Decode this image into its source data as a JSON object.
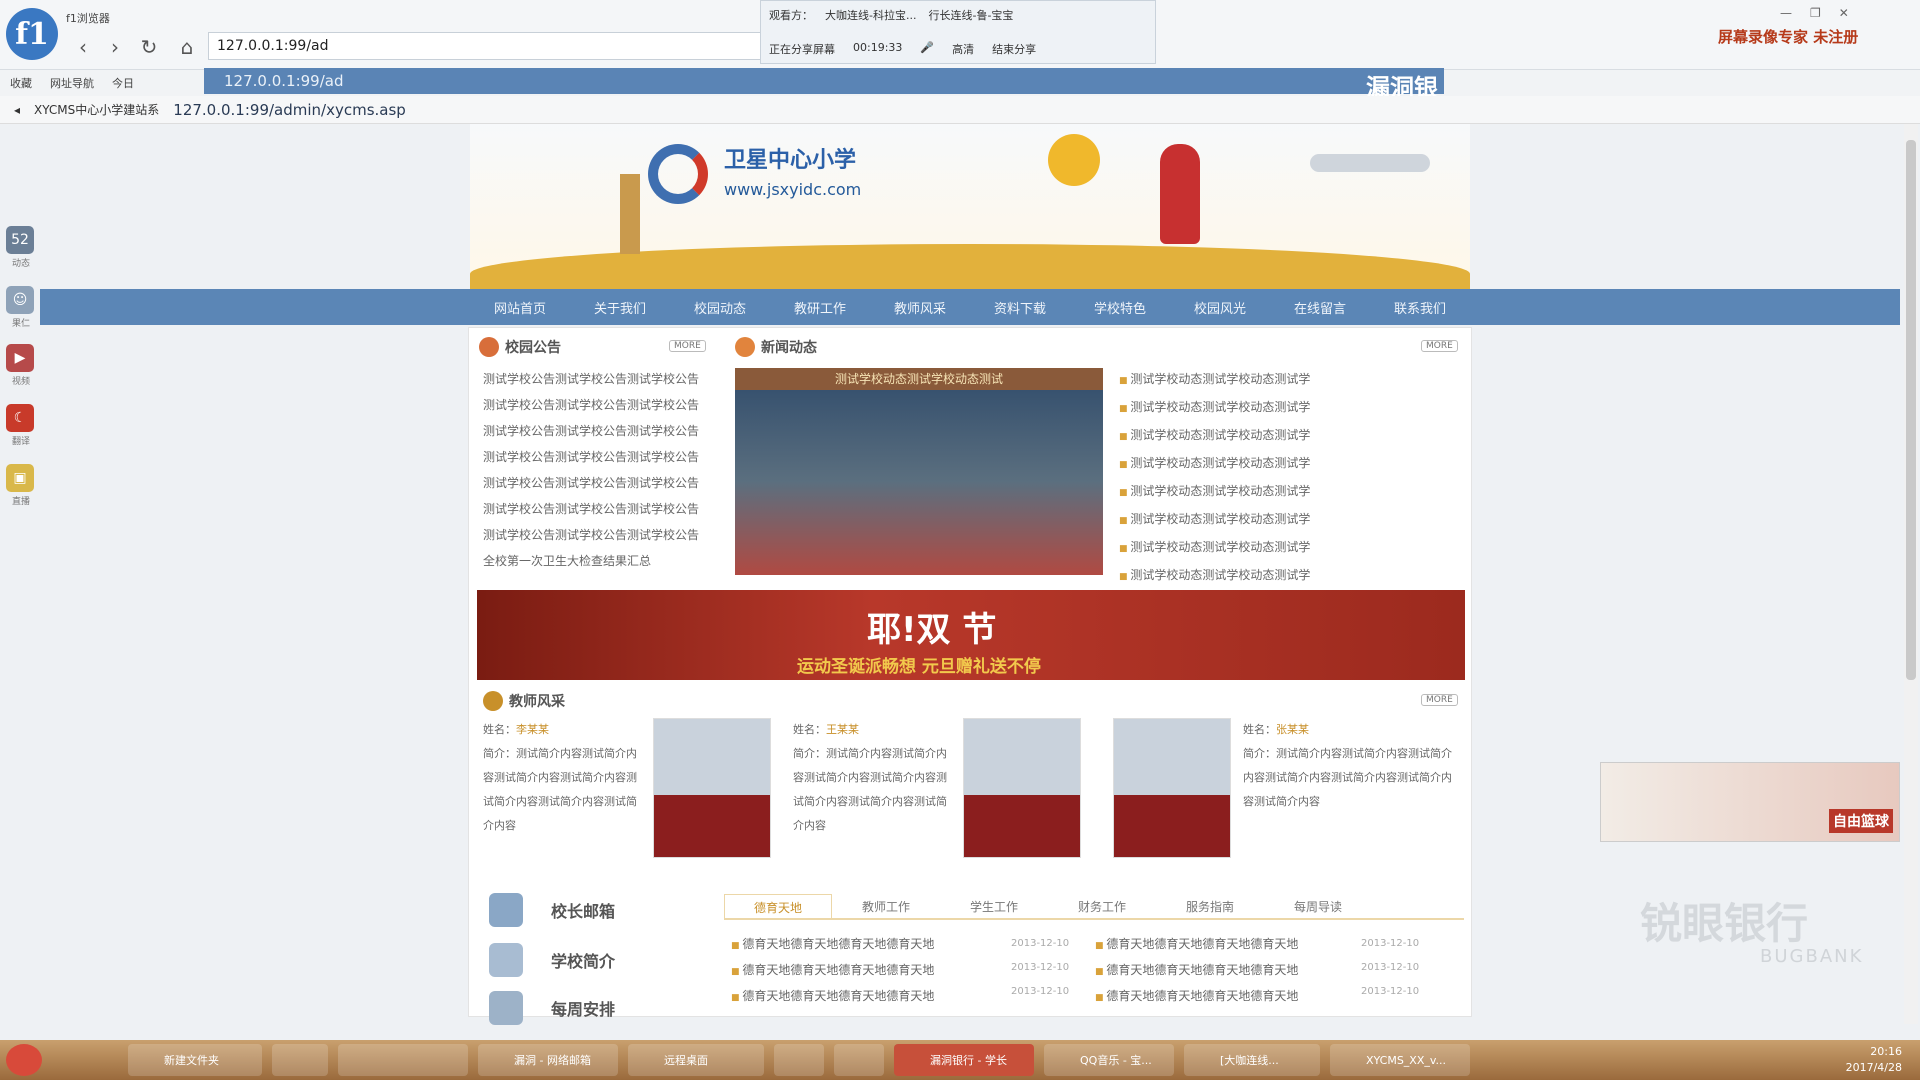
{
  "browser": {
    "app_title": "f1浏览器",
    "address_value": "127.0.0.1:99/ad",
    "suggestion_url": "127.0.0.1:99/ad",
    "tab_label": "XYCMS中心小学建站系",
    "tab_url": "127.0.0.1:99/admin/xycms.asp",
    "suggestion_tag": "漏洞银",
    "bookmarks": [
      "收藏",
      "网址导航",
      "今日"
    ]
  },
  "share_panel": {
    "viewer_label": "观看方：",
    "viewer1": "大咖连线-科拉宝...",
    "viewer2": "行长连线-鲁-宝宝",
    "status": "正在分享屏幕",
    "time": "00:19:33",
    "quality": "高清",
    "end": "结束分享"
  },
  "right_brand": "屏幕录像专家  未注册",
  "left_dock": [
    "动态",
    "果仁",
    "视频",
    "翻译",
    "直播"
  ],
  "site": {
    "school_name": "卫星中心小学",
    "school_url": "www.jsxyidc.com",
    "nav": [
      "网站首页",
      "关于我们",
      "校园动态",
      "教研工作",
      "教师风采",
      "资料下载",
      "学校特色",
      "校园风光",
      "在线留言",
      "联系我们"
    ],
    "notice_title": "校园公告",
    "notices": [
      "测试学校公告测试学校公告测试学校公告",
      "测试学校公告测试学校公告测试学校公告",
      "测试学校公告测试学校公告测试学校公告",
      "测试学校公告测试学校公告测试学校公告",
      "测试学校公告测试学校公告测试学校公告",
      "测试学校公告测试学校公告测试学校公告",
      "测试学校公告测试学校公告测试学校公告",
      "全校第一次卫生大检查结果汇总"
    ],
    "news_title": "新闻动态",
    "photo_caption": "测试学校动态测试学校动态测试",
    "news": [
      "测试学校动态测试学校动态测试学",
      "测试学校动态测试学校动态测试学",
      "测试学校动态测试学校动态测试学",
      "测试学校动态测试学校动态测试学",
      "测试学校动态测试学校动态测试学",
      "测试学校动态测试学校动态测试学",
      "测试学校动态测试学校动态测试学",
      "测试学校动态测试学校动态测试学"
    ],
    "more_label": "MORE",
    "promo_title": "耶!双 节",
    "promo_sub": "运动圣诞派畅想  元旦赠礼送不停",
    "teacher_title": "教师风采",
    "teachers": [
      {
        "name_label": "姓名：",
        "name": "李某某",
        "intro": "简介：测试简介内容测试简介内容测试简介内容测试简介内容测试简介内容测试简介内容测试简介内容"
      },
      {
        "name_label": "姓名：",
        "name": "王某某",
        "intro": "简介：测试简介内容测试简介内容测试简介内容测试简介内容测试简介内容测试简介内容测试简介内容"
      },
      {
        "name_label": "姓名：",
        "name": "张某某",
        "intro": "简介：测试简介内容测试简介内容测试简介内容测试简介内容测试简介内容测试简介内容测试简介内容"
      }
    ],
    "side_links": [
      "校长邮箱",
      "学校简介",
      "每周安排"
    ],
    "bottom_tabs": [
      "德育天地",
      "教师工作",
      "学生工作",
      "财务工作",
      "服务指南",
      "每周导读"
    ],
    "bottom_news_left": [
      "德育天地德育天地德育天地德育天地",
      "德育天地德育天地德育天地德育天地",
      "德育天地德育天地德育天地德育天地"
    ],
    "bottom_news_right": [
      "德育天地德育天地德育天地德育天地",
      "德育天地德育天地德育天地德育天地",
      "德育天地德育天地德育天地德育天地"
    ],
    "bottom_dates": [
      "2013-12-10",
      "2013-12-10",
      "2013-12-10"
    ]
  },
  "ad": {
    "tag": "自由篮球"
  },
  "watermark": {
    "cn": "锐眼银行",
    "en": "BUGBANK"
  },
  "taskbar": {
    "tasks": [
      "新建文件夹",
      "",
      "",
      "漏洞 - 网络邮箱",
      "远程桌面",
      "",
      "",
      "漏洞银行 - 学长",
      "QQ音乐 - 宝...",
      "[大咖连线...",
      "XYCMS_XX_v..."
    ],
    "time": "20:16",
    "date": "2017/4/28"
  }
}
